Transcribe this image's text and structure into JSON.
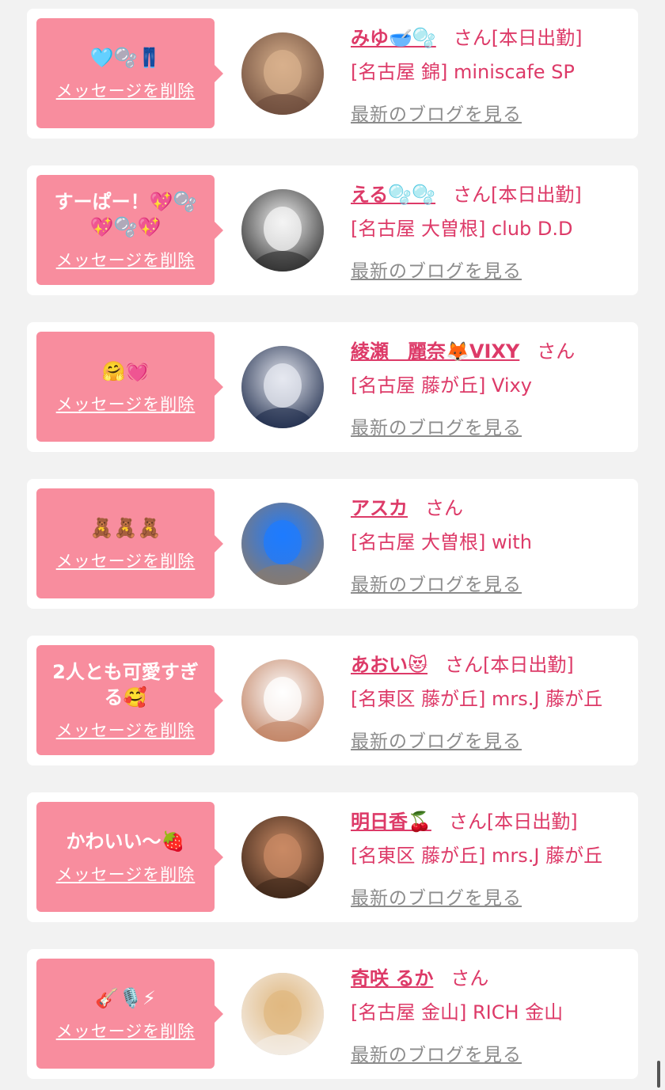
{
  "delete_label": "メッセージを削除",
  "blog_label": "最新のブログを見る",
  "san_suffix": "さん",
  "colors": {
    "bubble": "#f88d9e",
    "accent": "#dd3a68",
    "muted": "#8c8c8c",
    "background": "#f2f2f2"
  },
  "items": [
    {
      "message": "🩵🫧👖",
      "name": "みゆ🥣🫧",
      "status": "[本日出勤]",
      "shop": "[名古屋 錦] miniscafe SP",
      "avatar_icon": "avatar-photo-icon",
      "avatar_colors": [
        "#6b4a3a",
        "#d8b08c"
      ]
    },
    {
      "message": "すーぱー！💖🫧💖🫧💖",
      "name": "える🫧🫧",
      "status": "[本日出勤]",
      "shop": "[名古屋 大曽根] club D.D",
      "avatar_icon": "avatar-cat-filter-icon",
      "avatar_colors": [
        "#2a2a2a",
        "#f4f4f4"
      ]
    },
    {
      "message": "🤗💓",
      "name": "綾瀬　麗奈🦊VIXY",
      "status": "",
      "shop": "[名古屋 藤が丘] Vixy",
      "avatar_icon": "avatar-lace-photo-icon",
      "avatar_colors": [
        "#1c2a4a",
        "#e6e8f0"
      ]
    },
    {
      "message": "🧸🧸🧸",
      "name": "アスカ",
      "status": "",
      "shop": "[名古屋 大曽根] with",
      "avatar_icon": "avatar-blue-heart-icon",
      "avatar_colors": [
        "#8a7a6a",
        "#1e7bff"
      ]
    },
    {
      "message": "2人とも可愛すぎる🥰",
      "name": "あおい😻",
      "status": "[本日出勤]",
      "shop": "[名東区 藤が丘] mrs.J 藤が丘",
      "avatar_icon": "avatar-white-heart-icon",
      "avatar_colors": [
        "#c08060",
        "#ffffff"
      ]
    },
    {
      "message": "かわいい〜🍓",
      "name": "明日香🍒",
      "status": "[本日出勤]",
      "shop": "[名東区 藤が丘] mrs.J 藤が丘",
      "avatar_icon": "avatar-photo-icon",
      "avatar_colors": [
        "#3a2418",
        "#c98a64"
      ]
    },
    {
      "message": "🎸🎙️⚡",
      "name": "奇咲 るか",
      "status": "",
      "shop": "[名古屋 金山] RICH 金山",
      "avatar_icon": "avatar-magazine-cover-icon",
      "avatar_colors": [
        "#f4eee8",
        "#e0b880"
      ]
    }
  ]
}
